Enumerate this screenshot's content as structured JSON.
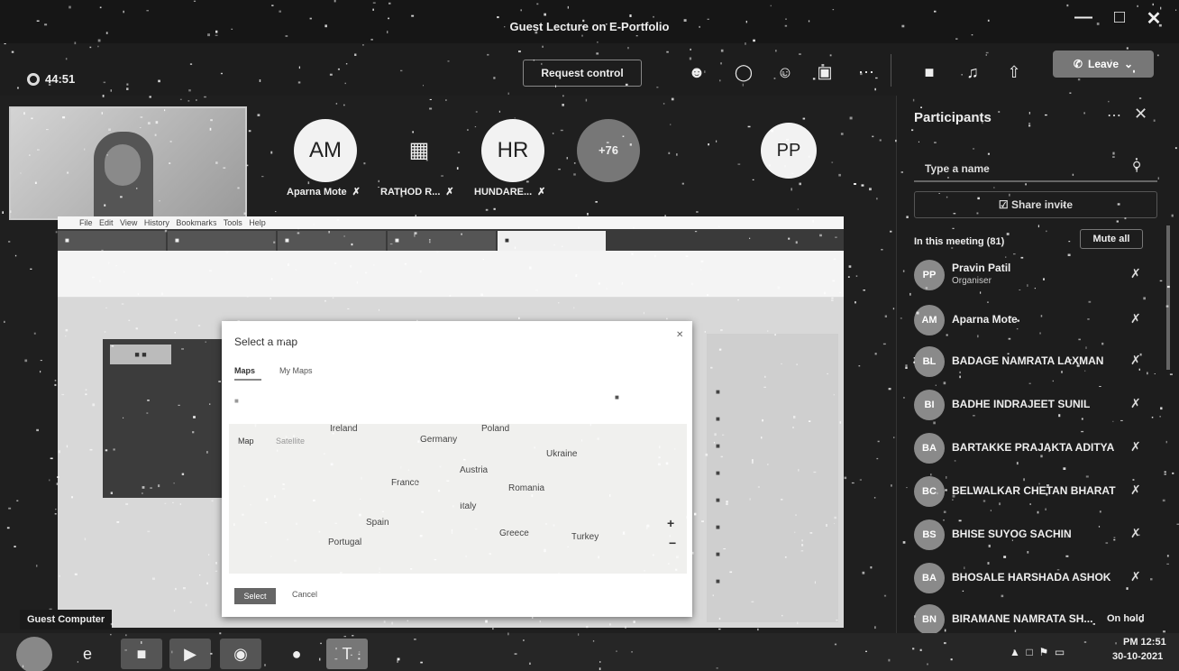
{
  "window": {
    "title": "Guest Lecture on E-Portfolio",
    "min_icon": "minimize-icon",
    "max_icon": "maximize-icon",
    "close_icon": "close-icon"
  },
  "toolbar": {
    "timer": "44:51",
    "request_control": "Request control",
    "leave_label": "Leave",
    "icons": [
      "people-icon",
      "chat-icon",
      "reactions-icon",
      "rooms-icon",
      "more-icon",
      "camera-icon",
      "mic-icon",
      "share-icon"
    ]
  },
  "video_strip": {
    "tiles": [
      {
        "initials": "AM",
        "name": "Aparna Mote"
      },
      {
        "initials": "",
        "name": "RATHOD R..."
      },
      {
        "initials": "HR",
        "name": "HUNDARE..."
      },
      {
        "initials": "+76",
        "name": ""
      },
      {
        "initials": "PP",
        "name": ""
      }
    ]
  },
  "shared_screen": {
    "presenter_label": "Guest Computer",
    "modal": {
      "title": "Select a map",
      "tab_maps": "Maps",
      "tab_mymaps": "My Maps",
      "map_tab": "Map",
      "satellite_tab": "Satellite",
      "select_label": "Select",
      "cancel_label": "Cancel",
      "countries": [
        "Ireland",
        "Poland",
        "Germany",
        "Ukraine",
        "France",
        "Austria",
        "Romania",
        "Italy",
        "Spain",
        "Greece",
        "Turkey",
        "Portugal"
      ]
    }
  },
  "participants": {
    "title": "Participants",
    "search_placeholder": "Type a name",
    "share_invite": "Share invite",
    "in_meeting": "In this meeting (81)",
    "mute_all": "Mute all",
    "list": [
      {
        "initials": "PP",
        "name": "Pravin Patil",
        "role": "Organiser",
        "status": ""
      },
      {
        "initials": "AM",
        "name": "Aparna Mote",
        "role": "",
        "status": ""
      },
      {
        "initials": "BL",
        "name": "BADAGE NAMRATA LAXMAN",
        "role": "",
        "status": ""
      },
      {
        "initials": "BI",
        "name": "BADHE INDRAJEET SUNIL",
        "role": "",
        "status": ""
      },
      {
        "initials": "BA",
        "name": "BARTAKKE PRAJAKTA ADITYA",
        "role": "",
        "status": ""
      },
      {
        "initials": "BC",
        "name": "BELWALKAR CHETAN BHARAT",
        "role": "",
        "status": ""
      },
      {
        "initials": "BS",
        "name": "BHISE SUYOG SACHIN",
        "role": "",
        "status": ""
      },
      {
        "initials": "BA",
        "name": "BHOSALE HARSHADA ASHOK",
        "role": "",
        "status": ""
      },
      {
        "initials": "BN",
        "name": "BIRAMANE NAMRATA SH...",
        "role": "",
        "status": "On hold"
      }
    ]
  },
  "taskbar": {
    "clock_time": "PM 12:51",
    "clock_date": "30-10-2021"
  }
}
